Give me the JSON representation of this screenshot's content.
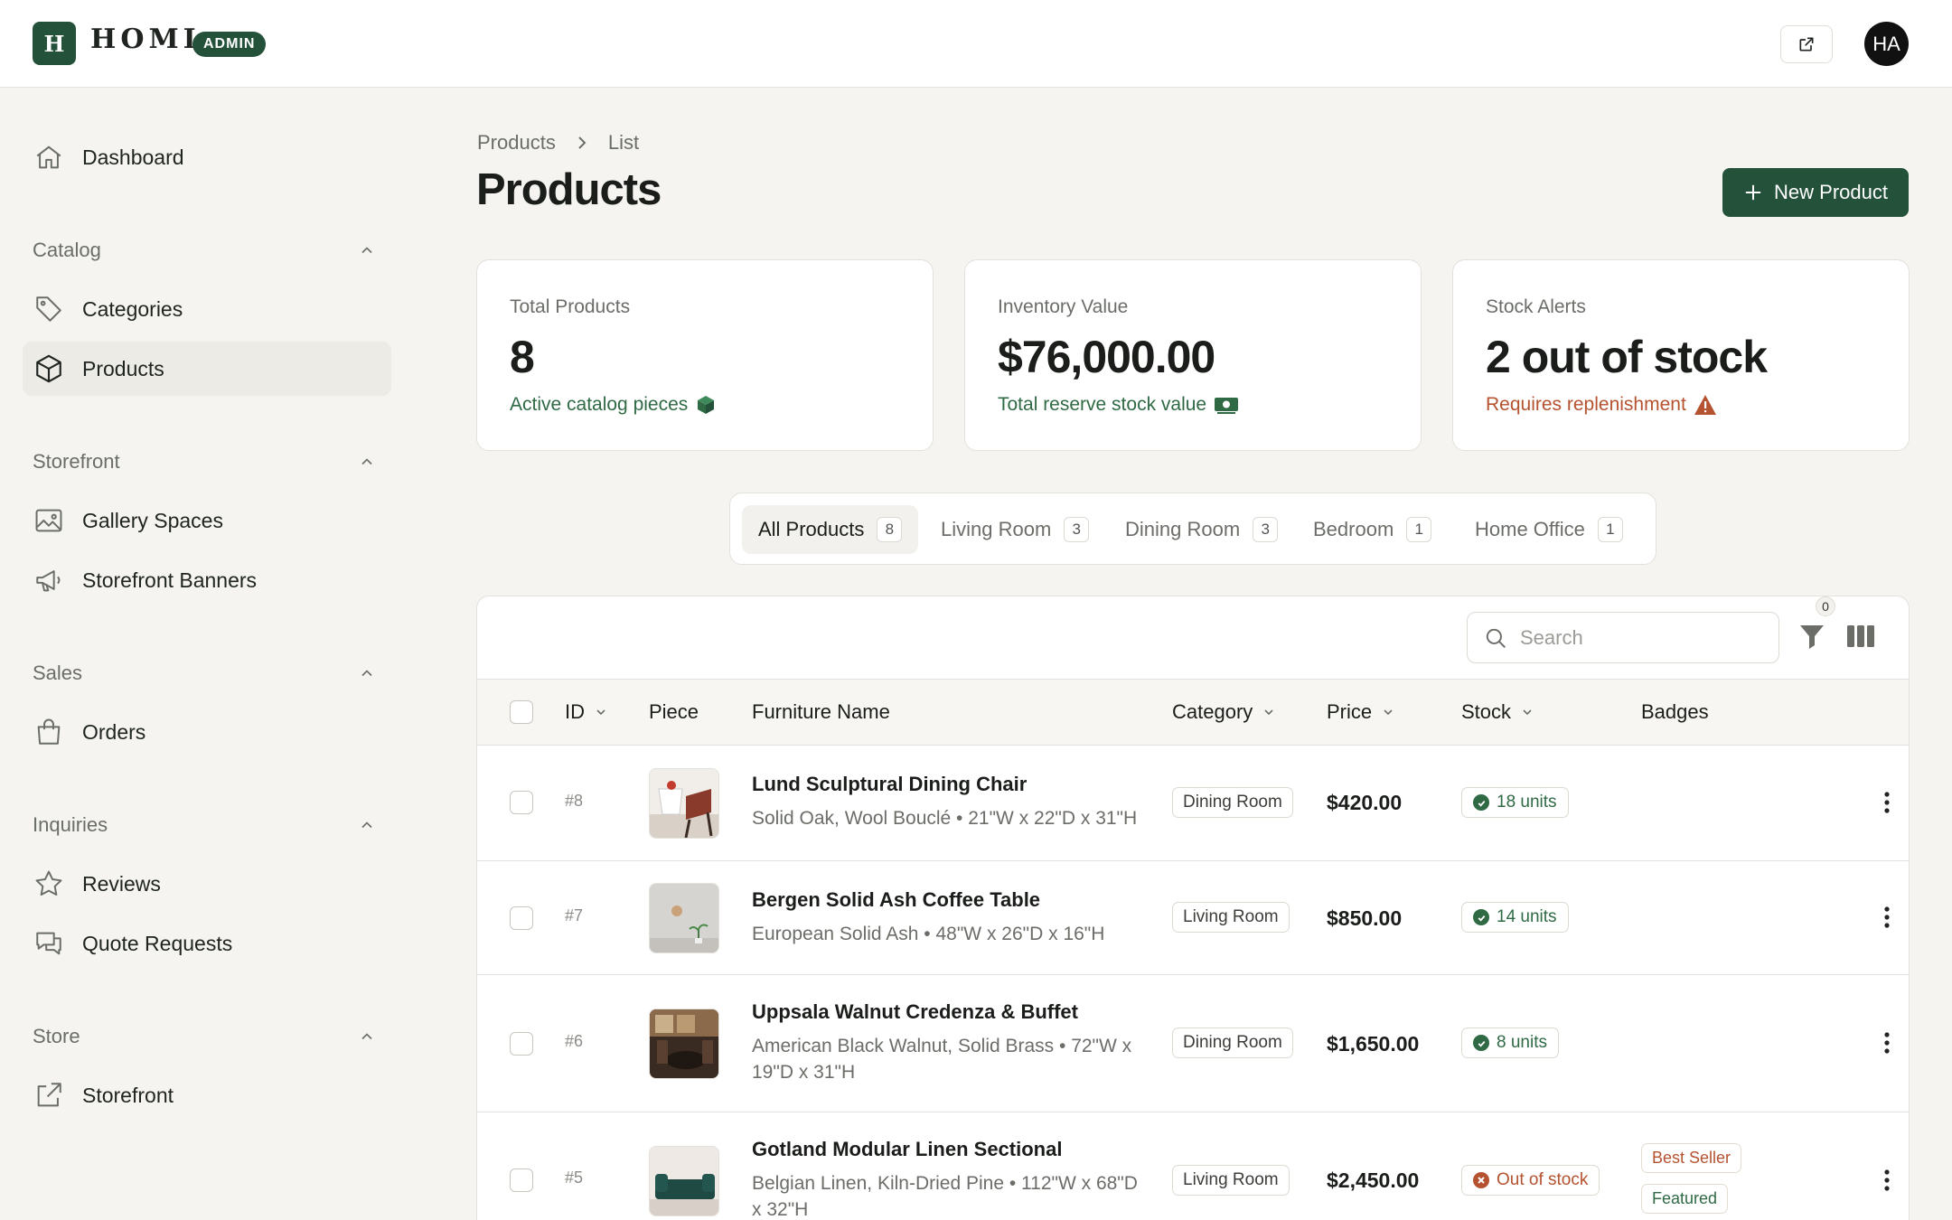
{
  "brand": {
    "initial": "H",
    "name": "HOMI",
    "badge": "ADMIN"
  },
  "user": {
    "initials": "HA"
  },
  "sidebar": {
    "dashboard": "Dashboard",
    "groups": [
      {
        "label": "Catalog",
        "items": [
          "Categories",
          "Products"
        ]
      },
      {
        "label": "Storefront",
        "items": [
          "Gallery Spaces",
          "Storefront Banners"
        ]
      },
      {
        "label": "Sales",
        "items": [
          "Orders"
        ]
      },
      {
        "label": "Inquiries",
        "items": [
          "Reviews",
          "Quote Requests"
        ]
      },
      {
        "label": "Store",
        "items": [
          "Storefront"
        ]
      }
    ]
  },
  "breadcrumb": [
    "Products",
    "List"
  ],
  "page": {
    "title": "Products",
    "new_button": "New Product"
  },
  "stats": [
    {
      "label": "Total Products",
      "value": "8",
      "sub": "Active catalog pieces",
      "sub_color": "#2f6a45"
    },
    {
      "label": "Inventory Value",
      "value": "$76,000.00",
      "sub": "Total reserve stock value",
      "sub_color": "#2f6a45"
    },
    {
      "label": "Stock Alerts",
      "value": "2 out of stock",
      "sub": "Requires replenishment",
      "sub_color": "#b5522f"
    }
  ],
  "tabs": [
    {
      "label": "All Products",
      "count": "8"
    },
    {
      "label": "Living Room",
      "count": "3"
    },
    {
      "label": "Dining Room",
      "count": "3"
    },
    {
      "label": "Bedroom",
      "count": "1"
    },
    {
      "label": "Home Office",
      "count": "1"
    }
  ],
  "table": {
    "search_placeholder": "Search",
    "filter_count": "0",
    "columns": {
      "id": "ID",
      "piece": "Piece",
      "name": "Furniture Name",
      "category": "Category",
      "price": "Price",
      "stock": "Stock",
      "badges": "Badges"
    },
    "rows": [
      {
        "id": "#8",
        "name": "Lund Sculptural Dining Chair",
        "desc": "Solid Oak, Wool Bouclé • 21\"W x 22\"D x 31\"H",
        "category": "Dining Room",
        "price": "$420.00",
        "stock": "18 units",
        "stock_status": "ok",
        "badges": []
      },
      {
        "id": "#7",
        "name": "Bergen Solid Ash Coffee Table",
        "desc": "European Solid Ash • 48\"W x 26\"D x 16\"H",
        "category": "Living Room",
        "price": "$850.00",
        "stock": "14 units",
        "stock_status": "ok",
        "badges": []
      },
      {
        "id": "#6",
        "name": "Uppsala Walnut Credenza & Buffet",
        "desc": "American Black Walnut, Solid Brass • 72\"W x 19\"D x 31\"H",
        "category": "Dining Room",
        "price": "$1,650.00",
        "stock": "8 units",
        "stock_status": "ok",
        "badges": []
      },
      {
        "id": "#5",
        "name": "Gotland Modular Linen Sectional",
        "desc": "Belgian Linen, Kiln-Dried Pine • 112\"W x 68\"D x 32\"H",
        "category": "Living Room",
        "price": "$2,450.00",
        "stock": "Out of stock",
        "stock_status": "out",
        "badges": [
          "Best Seller",
          "Featured"
        ]
      }
    ]
  },
  "colors": {
    "brand": "#24513a",
    "ok": "#2f6a45",
    "warn": "#b5522f",
    "badge_best": "#b5522f",
    "badge_featured": "#2f6a45"
  }
}
